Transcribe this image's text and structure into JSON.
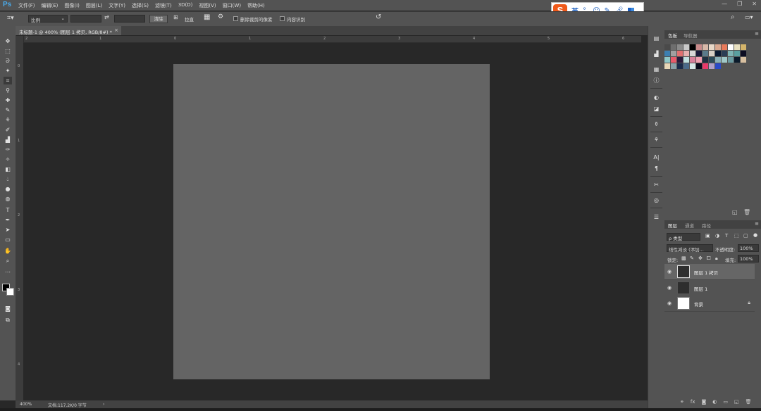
{
  "app": {
    "logo": "Ps",
    "menus": [
      "文件(F)",
      "编辑(E)",
      "图像(I)",
      "图层(L)",
      "文字(Y)",
      "选择(S)",
      "滤镜(T)",
      "3D(D)",
      "视图(V)",
      "窗口(W)",
      "帮助(H)"
    ],
    "window_controls": [
      "—",
      "❐",
      "✕"
    ]
  },
  "ime": {
    "logo": "S",
    "lang": "英"
  },
  "options": {
    "ratio_select": "比例",
    "clear_button": "清除",
    "straighten_label": "拉直",
    "delete_cropped_label": "删除裁剪的像素",
    "content_aware_label": "内容识别"
  },
  "document": {
    "tab_title": "未标题-1 @ 400% (图层 1 拷贝, RGB/8#) *",
    "tab_close": "×",
    "zoom": "400%",
    "doc_info": "文档:117.2K/0 字节",
    "status_arrow": "›"
  },
  "rulers": {
    "h_ticks": [
      "2",
      "1",
      "0",
      "1",
      "2",
      "3",
      "4",
      "5",
      "6",
      "7",
      "8"
    ],
    "v_ticks": [
      "0",
      "1",
      "2",
      "3",
      "4"
    ]
  },
  "panels": {
    "swatch_tabs": [
      "色板",
      "导航器"
    ],
    "layer_tabs": [
      "图层",
      "通道",
      "路径"
    ],
    "filter_kind": "ρ 类型",
    "blend_mode": "线性减淡 (添加...",
    "opacity_label": "不透明度:",
    "opacity_value": "100%",
    "lock_label": "锁定:",
    "fill_label": "填充:",
    "fill_value": "100%",
    "layers": [
      {
        "name": "图层 1 拷贝"
      },
      {
        "name": "图层 1"
      },
      {
        "name": "背景"
      }
    ]
  },
  "colors": {
    "canvas": "#646464",
    "swatches": [
      "#4a4a4a",
      "#6e6e6e",
      "#8a8a8a",
      "#c8c8c8",
      "#000000",
      "#c98c8c",
      "#d7b8a8",
      "#e8d8c8",
      "#d9a890",
      "#e97a5a",
      "#ffffff",
      "#e8e0c0",
      "#d4b46a",
      "#3c7fb1",
      "#a0a0a0",
      "#e07070",
      "#e6b0b0",
      "#d8d8d8",
      "#1a1a3a",
      "#5a7a8a",
      "#d8d0c8",
      "#0b1a33",
      "#2b3d55",
      "#7fb5b5",
      "#5aa0a0",
      "#0d0d22",
      "#8fc8c8",
      "#e85a6a",
      "#2a1a3a",
      "#c0e0e0",
      "#d8809a",
      "#f0a0b0",
      "#1e3040",
      "#2a4a5a",
      "#8ab0b8",
      "#a0c8c8",
      "#6a9aa0",
      "#0a1a2a",
      "#d8c0a0",
      "#e8d8b8",
      "#8aa0a8",
      "#1a2a4a",
      "#4a6a8a",
      "#d8e8e8",
      "#0a0a1a",
      "#e83a6a",
      "#b0a0c8",
      "#2a4ac8"
    ]
  }
}
